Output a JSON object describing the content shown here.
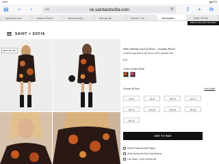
{
  "status_bar": {
    "time": "18:09",
    "date": "Tue 11 Jun",
    "battery": "52%"
  },
  "toolbar": {
    "url": "uk.saintandsofia.com",
    "aa_label": "AA",
    "icons": [
      "sidebar-icon",
      "back-icon",
      "forward-icon",
      "reload-icon",
      "share-icon",
      "new-tab-icon",
      "tabs-icon"
    ]
  },
  "tabs": [
    {
      "label": "saint&sofia.com"
    },
    {
      "label": "Autumn Printed..."
    },
    {
      "label": "Womens Knitw..."
    },
    {
      "label": "Blue girl gift..."
    },
    {
      "label": "Dresses + Sk..."
    },
    {
      "label": "Mini Adaline..."
    },
    {
      "label": "SAINT+SOFIA"
    }
  ],
  "promo": "FREE UK DELIVERY AVAILABLE",
  "header": {
    "logo": "SAINT + SOFIA"
  },
  "badge": "BEST SELLER",
  "product": {
    "title": "Mini Adaline Zip Up Dress - Autumn Floral",
    "subtitle": "A flared long sleeve mini dress with a pleated skirt",
    "price": "£75",
    "colour_label": "Colour: Autumn Floral",
    "size_label": "Choose UK Size:",
    "size_guide": "Size Guide",
    "sizes": [
      "UK 6",
      "UK 8",
      "UK 10",
      "UK 12",
      "UK 14",
      "UK 16",
      "UK 18",
      "UK 20",
      "UK 22"
    ],
    "add_to_bag": "ADD TO BAG",
    "info": [
      "Secure Payment with Paypal",
      "Order by 5pm for Next Day Delivery",
      "Low Stock - Only 10 items left"
    ]
  }
}
